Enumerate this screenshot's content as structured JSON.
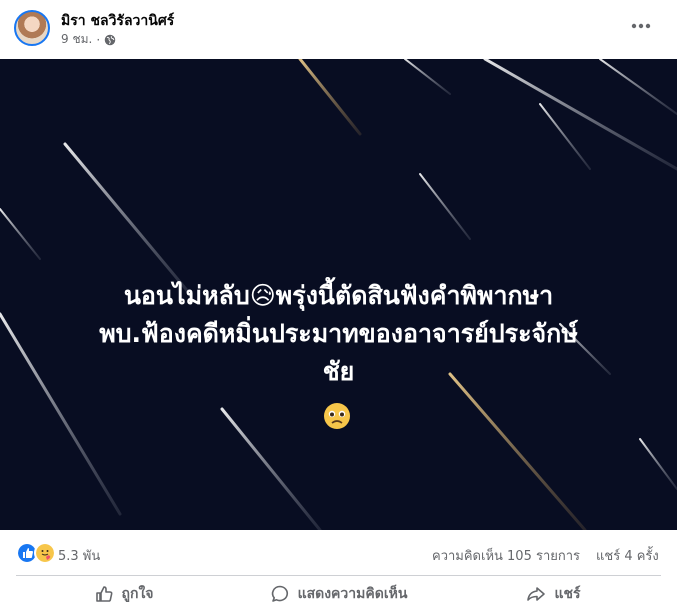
{
  "post": {
    "author": "มิรา ชลวิรัลวานิศร์",
    "time": "9 ชม.",
    "separator": "·",
    "overlay_lines": [
      "นอนไม่หลับ😥พรุ่งนี้ตัดสินฟังคำพิพากษา",
      "พบ.ฟ้องคดีหมิ่นประมาทของอาจารย์ประจักษ์",
      "ชัย"
    ],
    "overlay_emoji": "crying-face-emoji"
  },
  "stats": {
    "reactions": "5.3 พัน",
    "comments": "ความคิดเห็น 105 รายการ",
    "shares": "แชร์ 4 ครั้ง"
  },
  "actions": {
    "like": "ถูกใจ",
    "comment": "แสดงความคิดเห็น",
    "share": "แชร์"
  },
  "colors": {
    "image_background": "#080d22",
    "like_blue": "#1877f2",
    "secondary_text": "#65676b"
  }
}
